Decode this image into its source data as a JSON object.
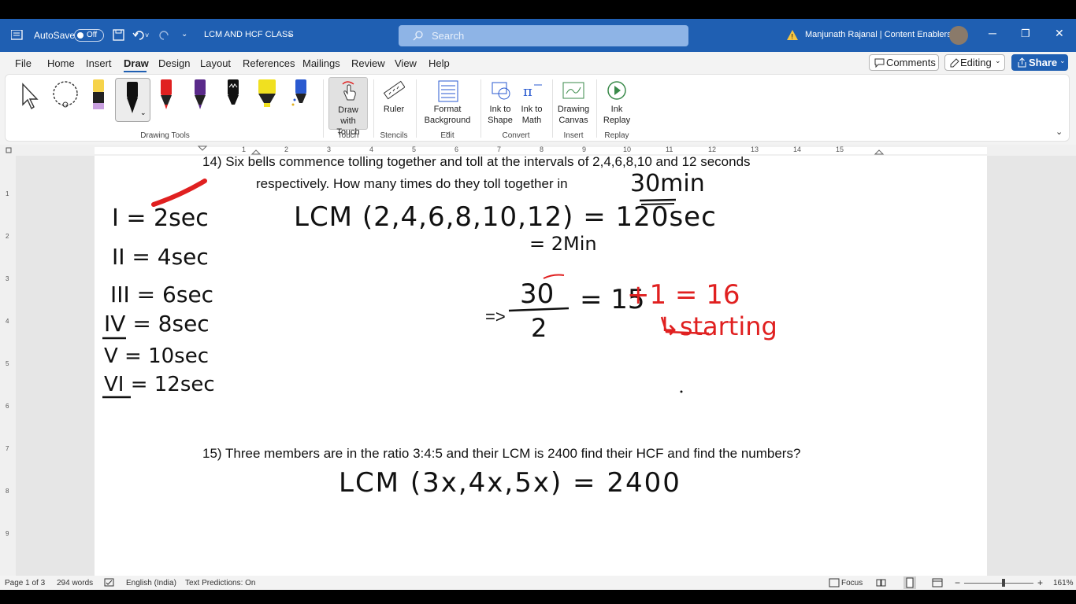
{
  "titlebar": {
    "autosave_label": "AutoSave",
    "autosave_state": "Off",
    "doc_title": "LCM AND HCF CLASS",
    "search_placeholder": "Search",
    "user": "Manjunath Rajanal | Content Enablers"
  },
  "menu": {
    "tabs": [
      "File",
      "Home",
      "Insert",
      "Draw",
      "Design",
      "Layout",
      "References",
      "Mailings",
      "Review",
      "View",
      "Help"
    ],
    "active_tab": "Draw",
    "comments_label": "Comments",
    "editing_label": "Editing",
    "share_label": "Share"
  },
  "ribbon": {
    "groups": {
      "drawing_tools": "Drawing Tools",
      "touch": "Touch",
      "stencils": "Stencils",
      "edit": "Edit",
      "convert": "Convert",
      "insert": "Insert",
      "replay": "Replay"
    },
    "buttons": {
      "draw_with_touch": [
        "Draw with",
        "Touch"
      ],
      "ruler": "Ruler",
      "format_background": [
        "Format",
        "Background"
      ],
      "ink_to_shape": [
        "Ink to",
        "Shape"
      ],
      "ink_to_math": [
        "Ink to",
        "Math"
      ],
      "drawing_canvas": [
        "Drawing",
        "Canvas"
      ],
      "ink_replay": [
        "Ink",
        "Replay"
      ]
    },
    "pen_colors": [
      "#f6d34a",
      "#111111",
      "#e02020",
      "#5a2a8a",
      "#111111",
      "#f0e020",
      "#2a5ad0"
    ]
  },
  "ruler_numbers": [
    "1",
    "1",
    "2",
    "3",
    "4",
    "5",
    "6",
    "7",
    "8",
    "9",
    "10",
    "11",
    "12",
    "13",
    "14",
    "15"
  ],
  "vruler_numbers": [
    "1",
    "2",
    "3",
    "4",
    "5",
    "6",
    "7",
    "8",
    "9"
  ],
  "document": {
    "q14_line1": "14) Six bells commence tolling together and toll at the intervals of 2,4,6,8,10 and 12   seconds",
    "q14_line2": "respectively. How many times do they toll together in",
    "q15": "15) Three members are in the ratio 3:4:5 and their LCM is 2400 find their HCF and find the numbers?",
    "ink": {
      "thirty_min": "30min",
      "bells": [
        "I = 2sec",
        "II = 4sec",
        "III = 6sec",
        "IV = 8sec",
        "V = 10sec",
        "VI = 12sec"
      ],
      "lcm_line": "LCM (2,4,6,8,10,12) = 120sec",
      "two_min": "= 2Min",
      "fraction_prefix": "=>",
      "numerator": "30",
      "denominator": "2",
      "equals_15": "= 15",
      "plus_one": "+1 = 16",
      "starting": "↳starting",
      "lcm_q15": "LCM (3x,4x,5x) = 2400"
    }
  },
  "status": {
    "page": "Page 1 of 3",
    "words": "294 words",
    "language": "English (India)",
    "predictions": "Text Predictions: On",
    "focus": "Focus",
    "zoom": "161%"
  }
}
